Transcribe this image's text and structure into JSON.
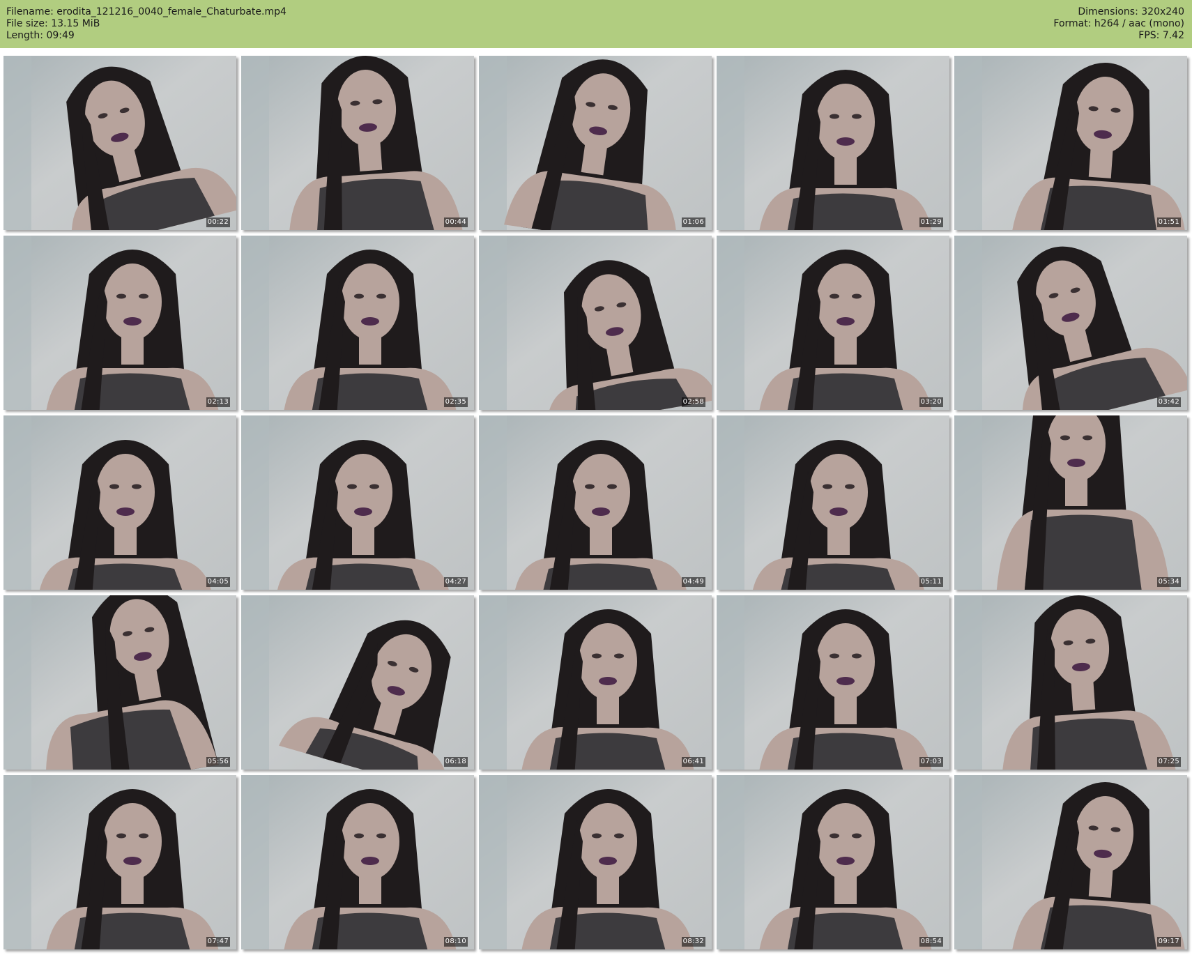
{
  "header": {
    "filename_line": "Filename: erodita_121216_0040_female_Chaturbate.mp4",
    "filesize_line": "File size: 13.15 MiB",
    "length_line": "Length: 09:49",
    "dimensions_line": "Dimensions: 320x240",
    "format_line": "Format: h264 / aac (mono)",
    "fps_line": "FPS: 7.42"
  },
  "colors": {
    "header_bg": "#b1cd80",
    "wall": "#c9cccd",
    "wall_shadow": "#a9b3b6",
    "hair": "#1f1b1c",
    "skin": "#b7a39c",
    "top": "#3d3b3e",
    "lips": "#4e2c4d"
  },
  "thumbnails": [
    {
      "time": "00:22",
      "pose": "tilt-left"
    },
    {
      "time": "00:44",
      "pose": "hand-chest"
    },
    {
      "time": "01:06",
      "pose": "hair-flip"
    },
    {
      "time": "01:29",
      "pose": "center"
    },
    {
      "time": "01:51",
      "pose": "right"
    },
    {
      "time": "02:13",
      "pose": "center"
    },
    {
      "time": "02:35",
      "pose": "center"
    },
    {
      "time": "02:58",
      "pose": "hand-face"
    },
    {
      "time": "03:20",
      "pose": "center"
    },
    {
      "time": "03:42",
      "pose": "tilt-left"
    },
    {
      "time": "04:05",
      "pose": "close"
    },
    {
      "time": "04:27",
      "pose": "close"
    },
    {
      "time": "04:49",
      "pose": "close"
    },
    {
      "time": "05:11",
      "pose": "close"
    },
    {
      "time": "05:34",
      "pose": "turned"
    },
    {
      "time": "05:56",
      "pose": "arm-up"
    },
    {
      "time": "06:18",
      "pose": "tilt-right"
    },
    {
      "time": "06:41",
      "pose": "center"
    },
    {
      "time": "07:03",
      "pose": "center"
    },
    {
      "time": "07:25",
      "pose": "hand-chest"
    },
    {
      "time": "07:47",
      "pose": "center"
    },
    {
      "time": "08:10",
      "pose": "center"
    },
    {
      "time": "08:32",
      "pose": "center"
    },
    {
      "time": "08:54",
      "pose": "center"
    },
    {
      "time": "09:17",
      "pose": "right"
    }
  ]
}
